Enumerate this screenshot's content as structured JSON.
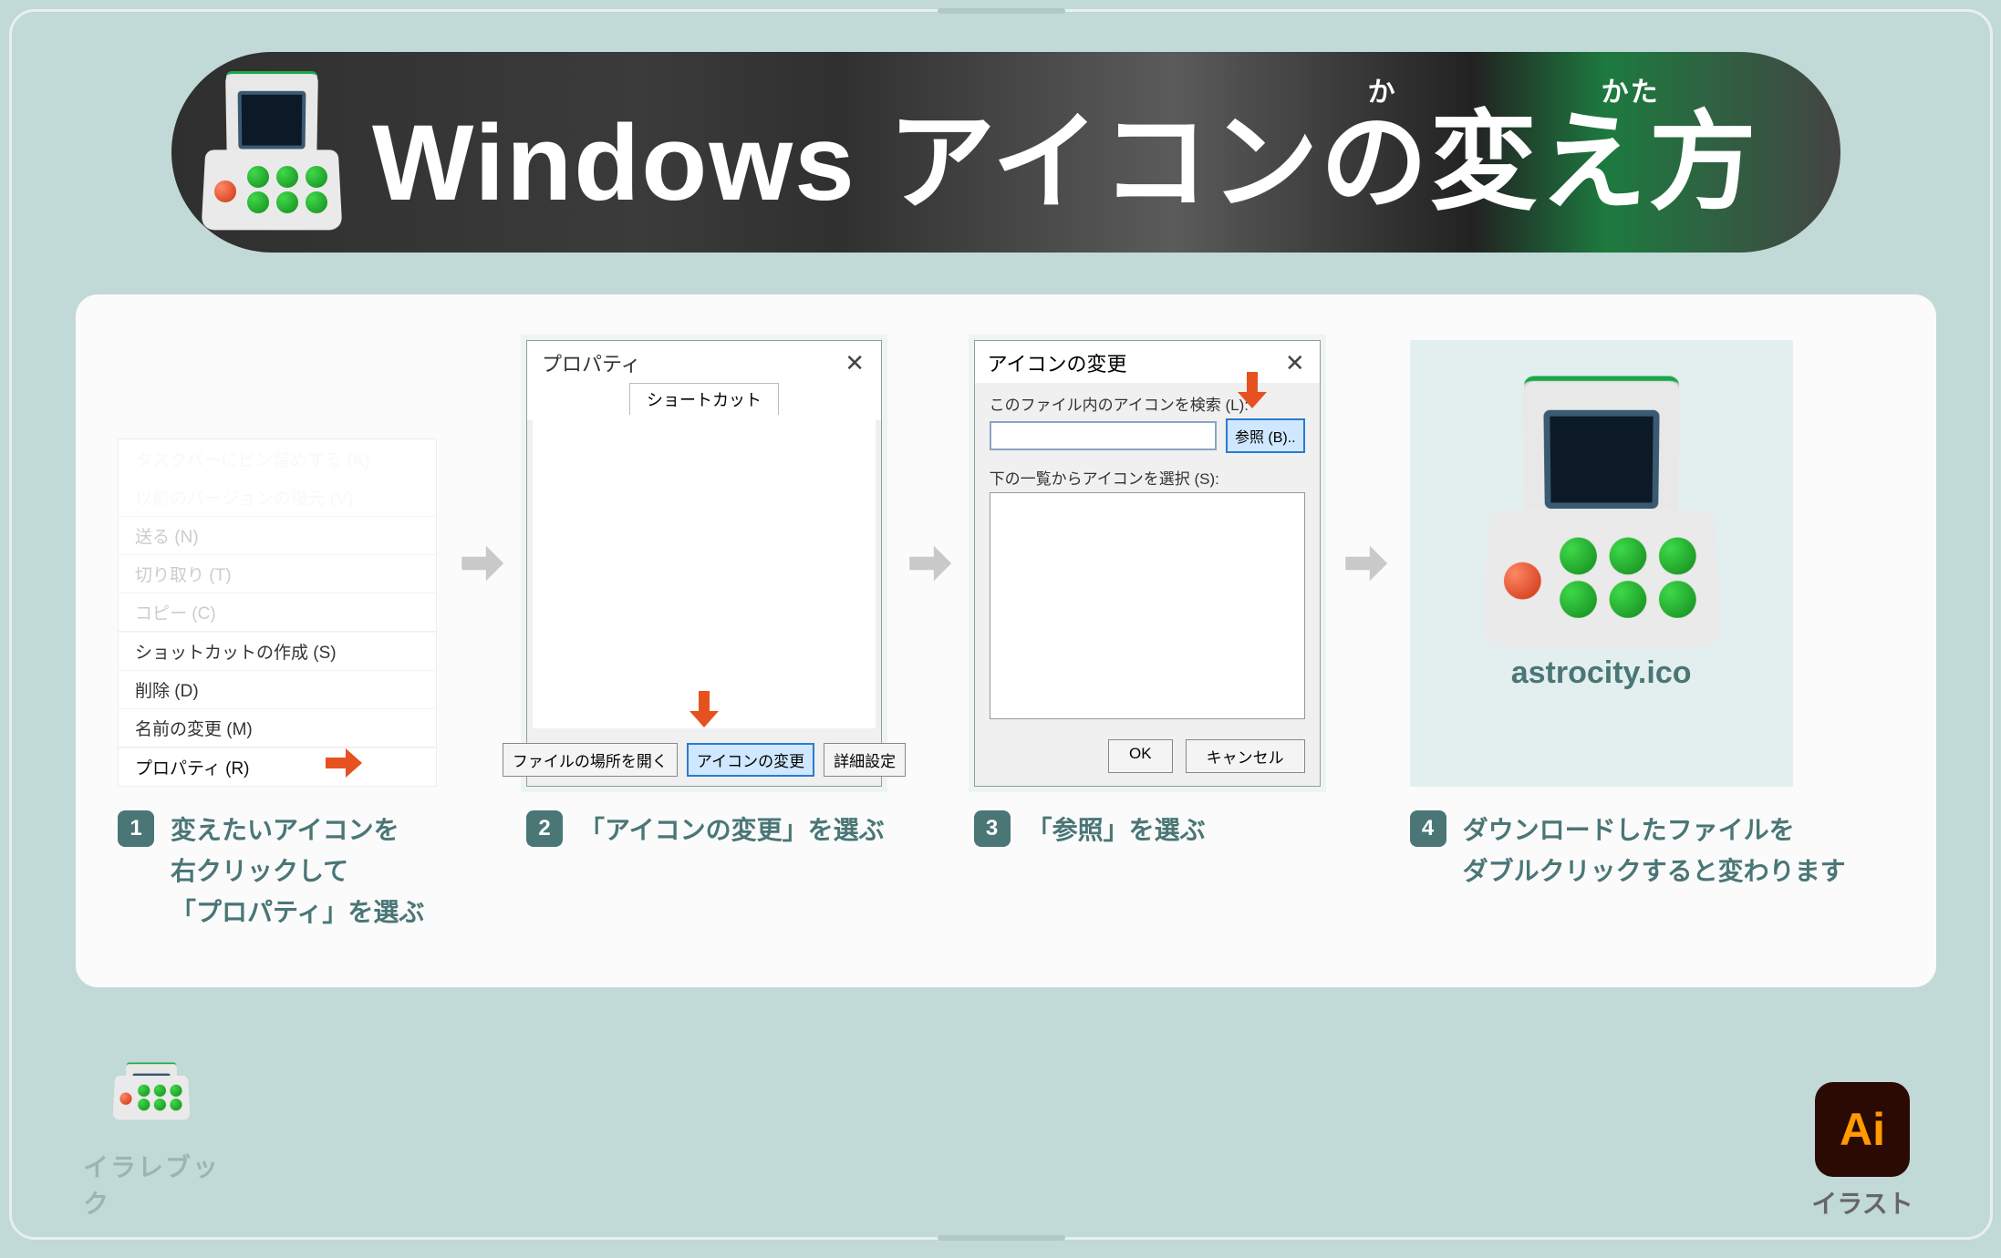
{
  "title": {
    "main": "Windows アイコンの変え方",
    "ruby_ka": "か",
    "ruby_kata": "かた"
  },
  "steps": [
    {
      "num": "1",
      "desc": "変えたいアイコンを\n右クリックして\n「プロパティ」を選ぶ",
      "context_menu": {
        "faded": [
          "タスクバーにピン留めする (K)",
          "以前のバージョンの復元 (V)"
        ],
        "items": [
          "送る (N)",
          "切り取り (T)",
          "コピー (C)",
          "ショットカットの作成 (S)",
          "削除 (D)",
          "名前の変更 (M)"
        ],
        "highlighted": "プロパティ (R)"
      }
    },
    {
      "num": "2",
      "desc": "「アイコンの変更」を選ぶ",
      "window": {
        "title": "プロパティ",
        "tab": "ショートカット",
        "buttons": {
          "open_location": "ファイルの場所を開く",
          "change_icon": "アイコンの変更",
          "advanced": "詳細設定"
        }
      }
    },
    {
      "num": "3",
      "desc": "「参照」を選ぶ",
      "dialog": {
        "title": "アイコンの変更",
        "search_label": "このファイル内のアイコンを検索 (L):",
        "browse": "参照 (B)..",
        "list_label": "下の一覧からアイコンを選択 (S):",
        "ok": "OK",
        "cancel": "キャンセル"
      }
    },
    {
      "num": "4",
      "desc": "ダウンロードしたファイルを\nダブルクリックすると変わります",
      "file_name": "astrocity.ico"
    }
  ],
  "footer": {
    "left_label": "イラレブック",
    "right_logo": "Ai",
    "right_label": "イラスト"
  }
}
